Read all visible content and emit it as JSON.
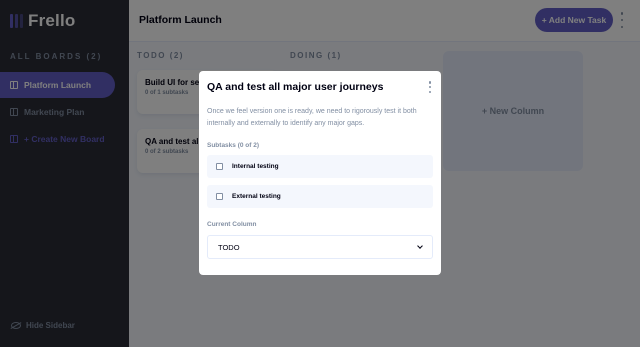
{
  "app": {
    "name": "Frello"
  },
  "sidebar": {
    "boards_title": "ALL BOARDS (2)",
    "items": [
      {
        "label": "Platform Launch",
        "active": true
      },
      {
        "label": "Marketing Plan",
        "active": false
      }
    ],
    "create_label": "+ Create New Board",
    "hide_label": "Hide Sidebar"
  },
  "header": {
    "title": "Platform Launch",
    "add_task_label": "+ Add New Task"
  },
  "board": {
    "columns": [
      {
        "title": "TODO (2)",
        "tasks": [
          {
            "title": "Build UI for search",
            "subtasks": "0 of 1 subtasks"
          },
          {
            "title": "QA and test all major user journeys",
            "subtasks": "0 of 2 subtasks"
          }
        ]
      },
      {
        "title": "DOING (1)",
        "tasks": []
      }
    ],
    "new_column_label": "+ New Column"
  },
  "modal": {
    "title": "QA and test all major user journeys",
    "description": "Once we feel version one is ready, we need to rigorously test it both internally and externally to identify any major gaps.",
    "subtasks_label": "Subtasks (0 of 2)",
    "subtasks": [
      {
        "title": "Internal testing",
        "done": false
      },
      {
        "title": "External testing",
        "done": false
      }
    ],
    "current_column_label": "Current Column",
    "current_column_value": "TODO"
  },
  "colors": {
    "accent": "#635fc7",
    "sidebar_bg": "#2b2c37",
    "board_bg": "#f4f7fd",
    "muted_text": "#828fa3"
  }
}
